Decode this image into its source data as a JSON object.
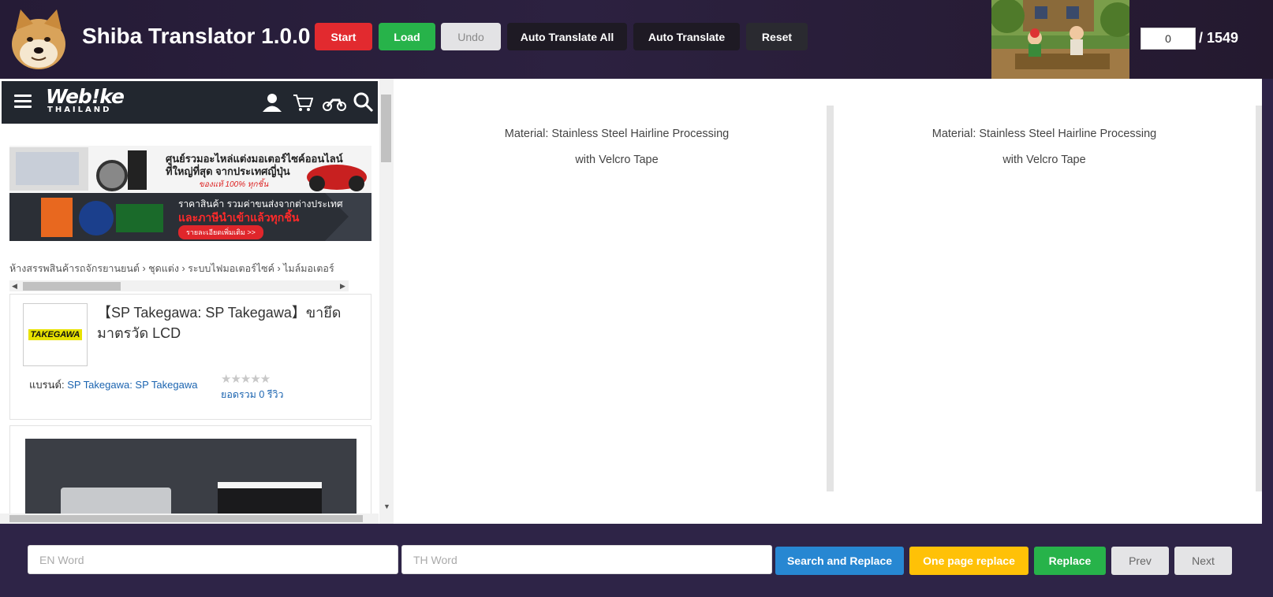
{
  "app": {
    "title": "Shiba Translator 1.0.0"
  },
  "toolbar": {
    "start_label": "Start",
    "load_label": "Load",
    "undo_label": "Undo",
    "auto_translate_all_label": "Auto Translate All",
    "auto_translate_label": "Auto Translate",
    "reset_label": "Reset",
    "page_value": "0",
    "page_total": "/ 1549"
  },
  "preview": {
    "site_logo": "Web!ke",
    "site_logo_sub": "THAILAND",
    "banner": {
      "line1": "ศูนย์รวมอะไหล่แต่งมอเตอร์ไซค์ออนไลน์",
      "line2": "ที่ใหญ่ที่สุด จากประเทศญี่ปุ่น",
      "line3": "ของแท้ 100% ทุกชิ้น",
      "line4": "ราคาสินค้า รวมค่าขนส่งจากต่างประเทศ",
      "line5": "และภาษีนำเข้าแล้วทุกชิ้น",
      "button": "รายละเอียดเพิ่มเติม >>"
    },
    "breadcrumb": "ห้างสรรพสินค้ารถจักรยานยนต์ › ชุดแต่ง › ระบบไฟมอเตอร์ไซค์ › ไมล์มอเตอร์",
    "brand_logo_text": "TAKEGAWA",
    "product_title": "【SP Takegawa: SP Takegawa】ขายึดมาตรวัด LCD",
    "brand_label": "แบรนด์:",
    "brand_name": "SP Takegawa: SP Takegawa",
    "stars": "★★★★★",
    "reviews": "ยอดรวม 0 รีวิว"
  },
  "translation": {
    "en_line1": "Material: Stainless Steel Hairline Processing",
    "en_line2": "with Velcro Tape",
    "th_line1": "Material: Stainless Steel Hairline Processing",
    "th_line2": "with Velcro Tape"
  },
  "replace_bar": {
    "en_placeholder": "EN Word",
    "th_placeholder": "TH Word",
    "search_replace_label": "Search and Replace",
    "one_page_replace_label": "One page replace",
    "replace_label": "Replace",
    "prev_label": "Prev",
    "next_label": "Next"
  },
  "colors": {
    "start": "#e22a2f",
    "load": "#27b34a",
    "search_replace": "#2787d2",
    "one_page_replace": "#ffc107",
    "background": "#2e2447"
  }
}
